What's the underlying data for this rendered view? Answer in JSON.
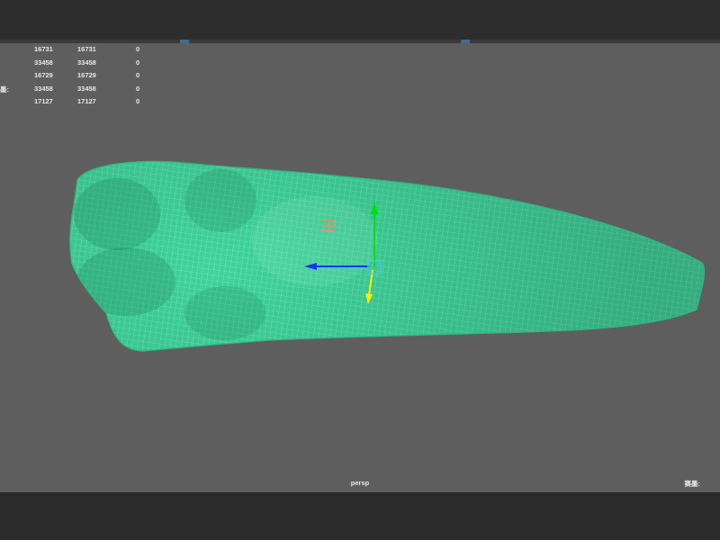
{
  "viewport": {
    "camera_label": "persp",
    "bottom_right_label": "赛墨:"
  },
  "hud": {
    "rows": [
      {
        "label": "",
        "col1": "16731",
        "col2": "16731",
        "col3": "0"
      },
      {
        "label": "",
        "col1": "33458",
        "col2": "33458",
        "col3": "0"
      },
      {
        "label": "",
        "col1": "16729",
        "col2": "16729",
        "col3": "0"
      },
      {
        "label": "墨:",
        "col1": "33458",
        "col2": "33458",
        "col3": "0"
      },
      {
        "label": "",
        "col1": "17127",
        "col2": "17127",
        "col3": "0"
      }
    ]
  },
  "colors": {
    "viewport_bg": "#5e5e5e",
    "mesh_fill": "#3fd39a",
    "mesh_wire": "#66f0b8",
    "manipulator_x": "#1a2fff",
    "manipulator_y": "#00e000",
    "manipulator_z": "#ffee00"
  },
  "icons": [
    "move-manipulator-icon",
    "pivot-icon"
  ]
}
